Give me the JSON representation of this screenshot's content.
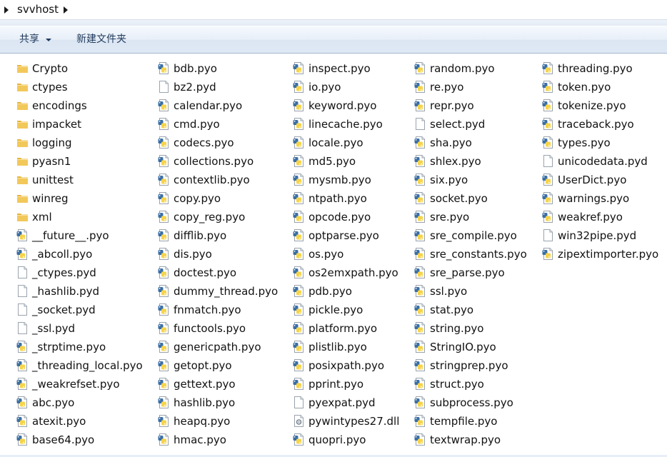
{
  "address": {
    "path": "svvhost"
  },
  "toolbar": {
    "share_label": "共享",
    "new_folder_label": "新建文件夹"
  },
  "columns": [
    [
      {
        "name": "Crypto",
        "type": "folder"
      },
      {
        "name": "ctypes",
        "type": "folder"
      },
      {
        "name": "encodings",
        "type": "folder"
      },
      {
        "name": "impacket",
        "type": "folder"
      },
      {
        "name": "logging",
        "type": "folder"
      },
      {
        "name": "pyasn1",
        "type": "folder"
      },
      {
        "name": "unittest",
        "type": "folder"
      },
      {
        "name": "winreg",
        "type": "folder"
      },
      {
        "name": "xml",
        "type": "folder"
      },
      {
        "name": "__future__.pyo",
        "type": "python"
      },
      {
        "name": "_abcoll.pyo",
        "type": "python"
      },
      {
        "name": "_ctypes.pyd",
        "type": "blank"
      },
      {
        "name": "_hashlib.pyd",
        "type": "blank"
      },
      {
        "name": "_socket.pyd",
        "type": "blank"
      },
      {
        "name": "_ssl.pyd",
        "type": "blank"
      },
      {
        "name": "_strptime.pyo",
        "type": "python"
      },
      {
        "name": "_threading_local.pyo",
        "type": "python"
      },
      {
        "name": "_weakrefset.pyo",
        "type": "python"
      },
      {
        "name": "abc.pyo",
        "type": "python"
      },
      {
        "name": "atexit.pyo",
        "type": "python"
      },
      {
        "name": "base64.pyo",
        "type": "python"
      }
    ],
    [
      {
        "name": "bdb.pyo",
        "type": "python"
      },
      {
        "name": "bz2.pyd",
        "type": "blank"
      },
      {
        "name": "calendar.pyo",
        "type": "python"
      },
      {
        "name": "cmd.pyo",
        "type": "python"
      },
      {
        "name": "codecs.pyo",
        "type": "python"
      },
      {
        "name": "collections.pyo",
        "type": "python"
      },
      {
        "name": "contextlib.pyo",
        "type": "python"
      },
      {
        "name": "copy.pyo",
        "type": "python"
      },
      {
        "name": "copy_reg.pyo",
        "type": "python"
      },
      {
        "name": "difflib.pyo",
        "type": "python"
      },
      {
        "name": "dis.pyo",
        "type": "python"
      },
      {
        "name": "doctest.pyo",
        "type": "python"
      },
      {
        "name": "dummy_thread.pyo",
        "type": "python"
      },
      {
        "name": "fnmatch.pyo",
        "type": "python"
      },
      {
        "name": "functools.pyo",
        "type": "python"
      },
      {
        "name": "genericpath.pyo",
        "type": "python"
      },
      {
        "name": "getopt.pyo",
        "type": "python"
      },
      {
        "name": "gettext.pyo",
        "type": "python"
      },
      {
        "name": "hashlib.pyo",
        "type": "python"
      },
      {
        "name": "heapq.pyo",
        "type": "python"
      },
      {
        "name": "hmac.pyo",
        "type": "python"
      }
    ],
    [
      {
        "name": "inspect.pyo",
        "type": "python"
      },
      {
        "name": "io.pyo",
        "type": "python"
      },
      {
        "name": "keyword.pyo",
        "type": "python"
      },
      {
        "name": "linecache.pyo",
        "type": "python"
      },
      {
        "name": "locale.pyo",
        "type": "python"
      },
      {
        "name": "md5.pyo",
        "type": "python"
      },
      {
        "name": "mysmb.pyo",
        "type": "python"
      },
      {
        "name": "ntpath.pyo",
        "type": "python"
      },
      {
        "name": "opcode.pyo",
        "type": "python"
      },
      {
        "name": "optparse.pyo",
        "type": "python"
      },
      {
        "name": "os.pyo",
        "type": "python"
      },
      {
        "name": "os2emxpath.pyo",
        "type": "python"
      },
      {
        "name": "pdb.pyo",
        "type": "python"
      },
      {
        "name": "pickle.pyo",
        "type": "python"
      },
      {
        "name": "platform.pyo",
        "type": "python"
      },
      {
        "name": "plistlib.pyo",
        "type": "python"
      },
      {
        "name": "posixpath.pyo",
        "type": "python"
      },
      {
        "name": "pprint.pyo",
        "type": "python"
      },
      {
        "name": "pyexpat.pyd",
        "type": "blank"
      },
      {
        "name": "pywintypes27.dll",
        "type": "dll"
      },
      {
        "name": "quopri.pyo",
        "type": "python"
      }
    ],
    [
      {
        "name": "random.pyo",
        "type": "python"
      },
      {
        "name": "re.pyo",
        "type": "python"
      },
      {
        "name": "repr.pyo",
        "type": "python"
      },
      {
        "name": "select.pyd",
        "type": "blank"
      },
      {
        "name": "sha.pyo",
        "type": "python"
      },
      {
        "name": "shlex.pyo",
        "type": "python"
      },
      {
        "name": "six.pyo",
        "type": "python"
      },
      {
        "name": "socket.pyo",
        "type": "python"
      },
      {
        "name": "sre.pyo",
        "type": "python"
      },
      {
        "name": "sre_compile.pyo",
        "type": "python"
      },
      {
        "name": "sre_constants.pyo",
        "type": "python"
      },
      {
        "name": "sre_parse.pyo",
        "type": "python"
      },
      {
        "name": "ssl.pyo",
        "type": "python"
      },
      {
        "name": "stat.pyo",
        "type": "python"
      },
      {
        "name": "string.pyo",
        "type": "python"
      },
      {
        "name": "StringIO.pyo",
        "type": "python"
      },
      {
        "name": "stringprep.pyo",
        "type": "python"
      },
      {
        "name": "struct.pyo",
        "type": "python"
      },
      {
        "name": "subprocess.pyo",
        "type": "python"
      },
      {
        "name": "tempfile.pyo",
        "type": "python"
      },
      {
        "name": "textwrap.pyo",
        "type": "python"
      }
    ],
    [
      {
        "name": "threading.pyo",
        "type": "python"
      },
      {
        "name": "token.pyo",
        "type": "python"
      },
      {
        "name": "tokenize.pyo",
        "type": "python"
      },
      {
        "name": "traceback.pyo",
        "type": "python"
      },
      {
        "name": "types.pyo",
        "type": "python"
      },
      {
        "name": "unicodedata.pyd",
        "type": "blank"
      },
      {
        "name": "UserDict.pyo",
        "type": "python"
      },
      {
        "name": "warnings.pyo",
        "type": "python"
      },
      {
        "name": "weakref.pyo",
        "type": "python"
      },
      {
        "name": "win32pipe.pyd",
        "type": "blank"
      },
      {
        "name": "zipextimporter.pyo",
        "type": "python"
      }
    ]
  ],
  "colors": {
    "toolbar_text": "#1e395b",
    "folder": "#f2c85a",
    "python_blue": "#3b6fa4",
    "python_yellow": "#f6d44a"
  }
}
